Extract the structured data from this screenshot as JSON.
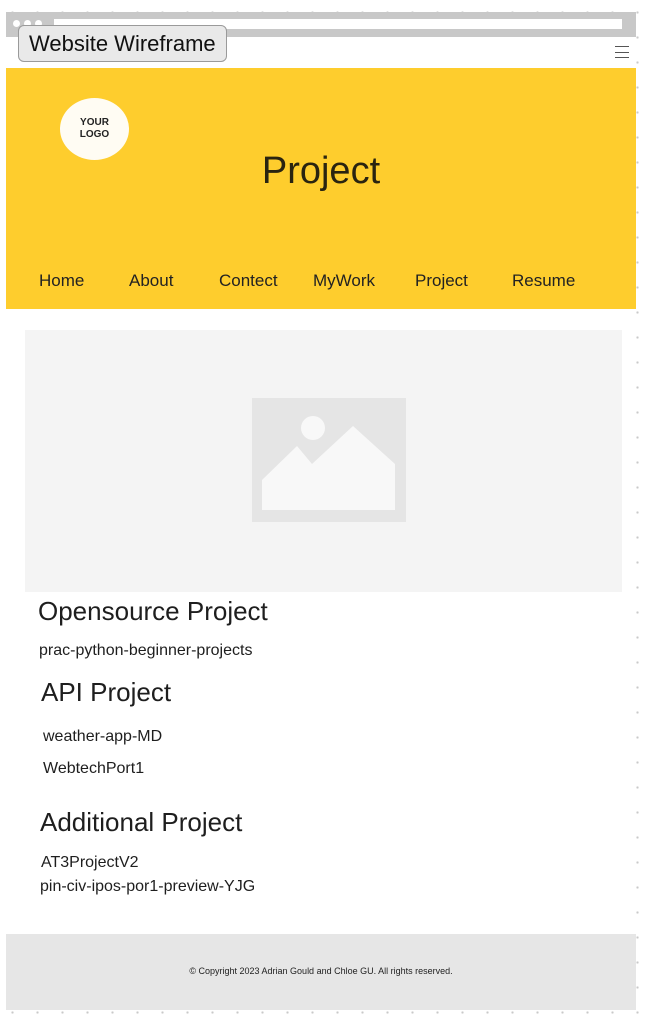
{
  "frame_title": "Website Wireframe",
  "header": {
    "logo_text": "YOUR\nLOGO",
    "title": "Project"
  },
  "nav": [
    "Home",
    "About",
    "Contect",
    "MyWork",
    "Project",
    "Resume"
  ],
  "sections": {
    "opensource": {
      "heading": "Opensource Project",
      "items": [
        "prac-python-beginner-projects"
      ]
    },
    "api": {
      "heading": "API Project",
      "items": [
        "weather-app-MD",
        "WebtechPort1"
      ]
    },
    "additional": {
      "heading": "Additional Project",
      "items": [
        "AT3ProjectV2",
        "pin-civ-ipos-por1-preview-YJG"
      ]
    }
  },
  "footer": {
    "copyright": "© Copyright 2023 Adrian Gould and Chloe GU. All rights reserved."
  },
  "colors": {
    "hero": "#fecd2d",
    "footer": "#e6e6e6",
    "image_placeholder": "#f4f4f4"
  },
  "icons": [
    "menu-icon",
    "image-placeholder-icon"
  ]
}
